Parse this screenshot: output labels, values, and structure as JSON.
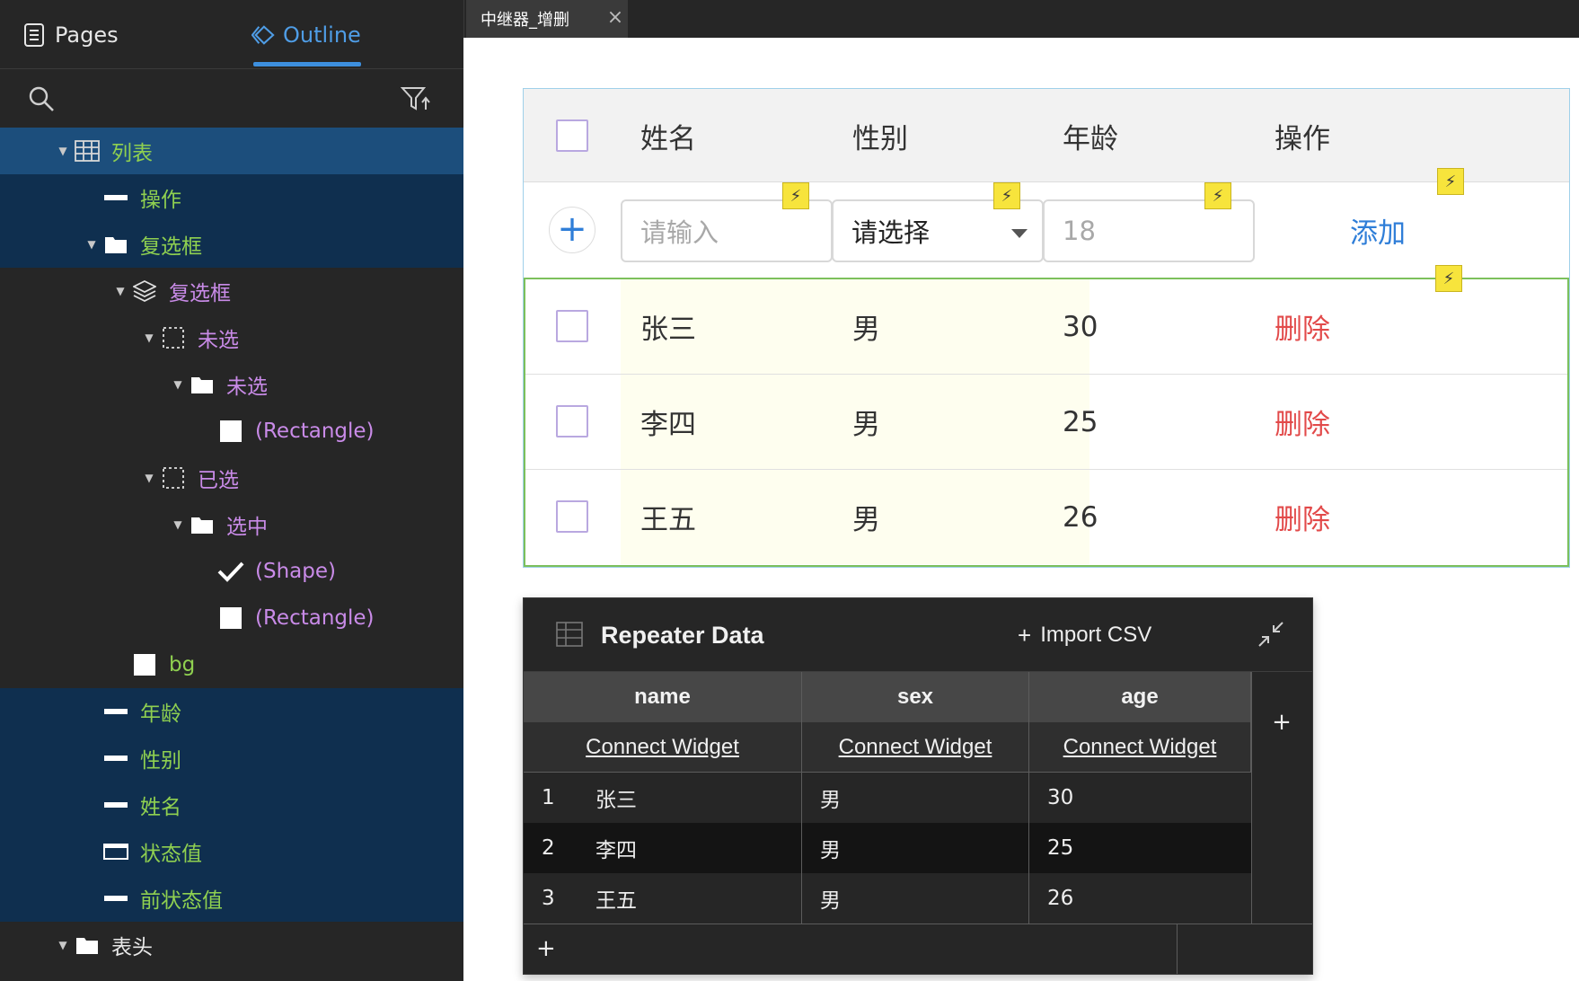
{
  "panel": {
    "tabs": {
      "pages": "Pages",
      "outline": "Outline"
    },
    "tree": [
      {
        "label": "列表",
        "icon": "table-icon",
        "color": "green",
        "depth": 0,
        "caret": true,
        "sel": "strong"
      },
      {
        "label": "操作",
        "icon": "text-field-icon",
        "color": "green",
        "depth": 1,
        "caret": false,
        "sel": "sel"
      },
      {
        "label": "复选框",
        "icon": "folder-icon",
        "color": "green",
        "depth": 1,
        "caret": true,
        "sel": "sel"
      },
      {
        "label": "复选框",
        "icon": "layers-icon",
        "color": "purple",
        "depth": 2,
        "caret": true,
        "sel": "none"
      },
      {
        "label": "未选",
        "icon": "dashed-box-icon",
        "color": "purple",
        "depth": 3,
        "caret": true,
        "sel": "none"
      },
      {
        "label": "未选",
        "icon": "folder-icon",
        "color": "purple",
        "depth": 4,
        "caret": true,
        "sel": "none"
      },
      {
        "label": "(Rectangle)",
        "icon": "rectangle-icon",
        "color": "purple",
        "depth": 5,
        "caret": false,
        "sel": "none"
      },
      {
        "label": "已选",
        "icon": "dashed-box-icon",
        "color": "purple",
        "depth": 3,
        "caret": true,
        "sel": "none"
      },
      {
        "label": "选中",
        "icon": "folder-icon",
        "color": "purple",
        "depth": 4,
        "caret": true,
        "sel": "none"
      },
      {
        "label": "(Shape)",
        "icon": "checkmark-icon",
        "color": "purple",
        "depth": 5,
        "caret": false,
        "sel": "none"
      },
      {
        "label": "(Rectangle)",
        "icon": "rectangle-icon",
        "color": "purple",
        "depth": 5,
        "caret": false,
        "sel": "none"
      },
      {
        "label": "bg",
        "icon": "rectangle-icon",
        "color": "green",
        "depth": 2,
        "caret": false,
        "sel": "none"
      },
      {
        "label": "年龄",
        "icon": "text-field-icon",
        "color": "green",
        "depth": 1,
        "caret": false,
        "sel": "sel"
      },
      {
        "label": "性别",
        "icon": "text-field-icon",
        "color": "green",
        "depth": 1,
        "caret": false,
        "sel": "sel"
      },
      {
        "label": "姓名",
        "icon": "text-field-icon",
        "color": "green",
        "depth": 1,
        "caret": false,
        "sel": "sel"
      },
      {
        "label": "状态值",
        "icon": "input-box-icon",
        "color": "green",
        "depth": 1,
        "caret": false,
        "sel": "sel"
      },
      {
        "label": "前状态值",
        "icon": "text-field-icon",
        "color": "green",
        "depth": 1,
        "caret": false,
        "sel": "sel"
      },
      {
        "label": "表头",
        "icon": "folder-icon",
        "color": "white",
        "depth": 0,
        "caret": true,
        "sel": "none"
      }
    ]
  },
  "doc_tab": {
    "title": "中继器_增删",
    "close": "×"
  },
  "repeater": {
    "headers": {
      "name": "姓名",
      "sex": "性别",
      "age": "年龄",
      "action": "操作"
    },
    "add_row": {
      "add_symbol": "+",
      "name_placeholder": "请输入",
      "sex_select": "请选择",
      "age_value": "18",
      "add_link": "添加"
    },
    "rows": [
      {
        "name": "张三",
        "sex": "男",
        "age": "30",
        "action": "删除"
      },
      {
        "name": "李四",
        "sex": "男",
        "age": "25",
        "action": "删除"
      },
      {
        "name": "王五",
        "sex": "男",
        "age": "26",
        "action": "删除"
      }
    ],
    "interaction_marker": "⚡"
  },
  "repeater_data": {
    "title": "Repeater Data",
    "import_label": "Import CSV",
    "plus": "+",
    "columns": [
      {
        "name": "name",
        "connect": "Connect Widget"
      },
      {
        "name": "sex",
        "connect": "Connect Widget"
      },
      {
        "name": "age",
        "connect": "Connect Widget"
      }
    ],
    "rows": [
      {
        "index": "1",
        "name": "张三",
        "sex": "男",
        "age": "30"
      },
      {
        "index": "2",
        "name": "李四",
        "sex": "男",
        "age": "25"
      },
      {
        "index": "3",
        "name": "王五",
        "sex": "男",
        "age": "26"
      }
    ]
  },
  "colors": {
    "accent": "#3d8fde",
    "tree_green": "#8fd050",
    "tree_purple": "#c98be8",
    "delete_red": "#e24a4a",
    "link_blue": "#2f7ed8",
    "bolt_yellow": "#f7e43c"
  }
}
